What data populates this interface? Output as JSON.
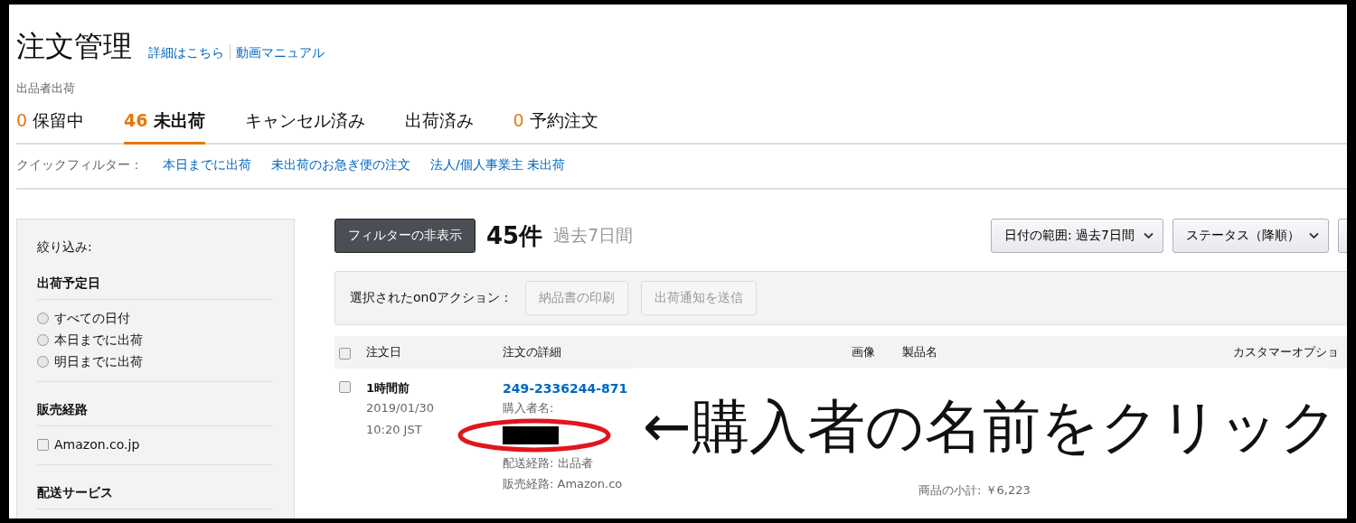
{
  "header": {
    "title": "注文管理",
    "links": [
      "詳細はこちら",
      "動画マニュアル"
    ]
  },
  "section_label": "出品者出荷",
  "tabs": [
    {
      "count": "0",
      "label": "保留中",
      "selected": false
    },
    {
      "count": "46",
      "label": "未出荷",
      "selected": true
    },
    {
      "label": "キャンセル済み",
      "selected": false
    },
    {
      "label": "出荷済み",
      "selected": false
    },
    {
      "count": "0",
      "label": "予約注文",
      "selected": false
    }
  ],
  "quick_filters": {
    "label": "クイックフィルター：",
    "links": [
      "本日までに出荷",
      "未出荷のお急ぎ便の注文",
      "法人/個人事業主 未出荷"
    ]
  },
  "sidebar": {
    "title": "絞り込み:",
    "groups": [
      {
        "heading": "出荷予定日",
        "kind": "radio",
        "options": [
          {
            "label": "すべての日付",
            "selected": false
          },
          {
            "label": "本日までに出荷",
            "selected": false
          },
          {
            "label": "明日までに出荷",
            "selected": false
          }
        ]
      },
      {
        "heading": "販売経路",
        "kind": "checkbox",
        "options": [
          {
            "label": "Amazon.co.jp",
            "checked": false
          }
        ]
      },
      {
        "heading": "配送サービス"
      }
    ]
  },
  "toolbar": {
    "filter_button": "フィルターの非表示",
    "count": "45件",
    "period": "過去7日間",
    "dropdowns": [
      {
        "kind": "select",
        "label": "日付の範囲: 過去7日間"
      },
      {
        "kind": "select",
        "label": "ステータス（降順）"
      },
      {
        "kind": "cut-off"
      }
    ]
  },
  "actions": {
    "label": "選択されたon0アクション：",
    "buttons": [
      {
        "label": "納品書の印刷",
        "disabled": true
      },
      {
        "label": "出荷通知を送信",
        "disabled": true
      }
    ]
  },
  "table": {
    "select_all_checked": false,
    "columns": [
      "注文日",
      "注文の詳細",
      "画像",
      "製品名",
      "カスタマーオプショ"
    ],
    "rows": [
      {
        "checked": false,
        "age": "1時間前",
        "date": "2019/01/30",
        "time": "10:20 JST",
        "order_id": "249-2336244-871",
        "buyer_label": "購入者名:",
        "shipping": "配送経路: 出品者",
        "channel": "販売経路: Amazon.co",
        "subtotal": "商品の小計: ￥6,223"
      }
    ]
  },
  "annotation": {
    "text": "←購入者の名前をクリック"
  }
}
